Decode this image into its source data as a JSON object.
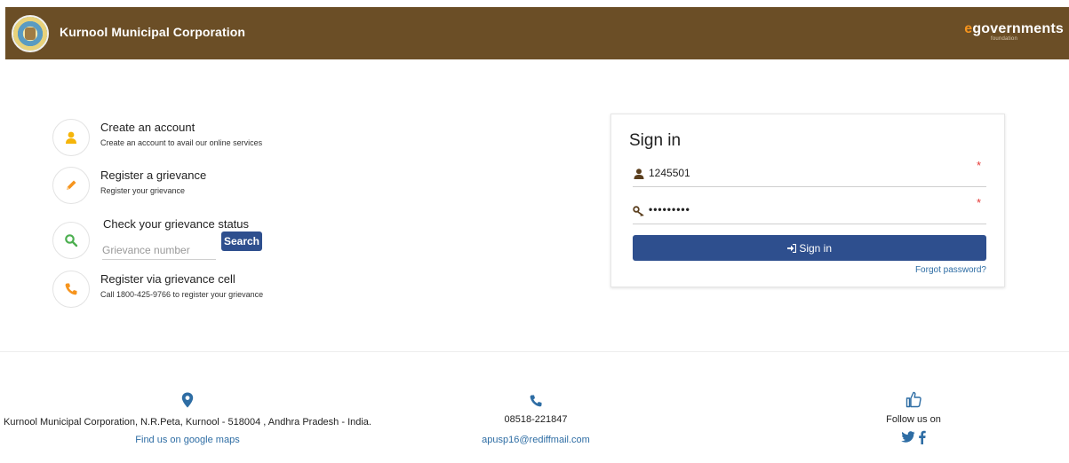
{
  "header": {
    "org_name": "Kurnool Municipal Corporation",
    "brand": {
      "prefix": "e",
      "main": "governments",
      "sub": "foundation"
    }
  },
  "services": [
    {
      "title": "Create an account",
      "subtitle": "Create an account to avail our online services",
      "icon": "user-icon"
    },
    {
      "title": "Register a grievance",
      "subtitle": "Register your grievance",
      "icon": "pencil-icon"
    },
    {
      "title": "Check your grievance status",
      "search_placeholder": "Grievance number",
      "search_button": "Search",
      "icon": "search-icon"
    },
    {
      "title": "Register via grievance cell",
      "subtitle": "Call 1800-425-9766 to register your grievance",
      "icon": "phone-icon"
    }
  ],
  "signin": {
    "title": "Sign in",
    "username": "1245501",
    "password_mask": "•••••••••",
    "required_mark": "*",
    "button_label": "Sign in",
    "forgot": "Forgot password?"
  },
  "footer": {
    "address": "Kurnool Municipal Corporation, N.R.Peta, Kurnool - 518004 , Andhra Pradesh - India.",
    "maps_link": "Find us on google maps",
    "phone": "08518-221847",
    "email": "apusp16@rediffmail.com",
    "follow": "Follow us on"
  },
  "colors": {
    "header_bg": "#6b4e26",
    "primary": "#2e4f8e",
    "accent_orange": "#f6941d",
    "icon_yellow": "#f5b50a",
    "icon_green": "#4caf50",
    "link": "#2e6da4"
  }
}
